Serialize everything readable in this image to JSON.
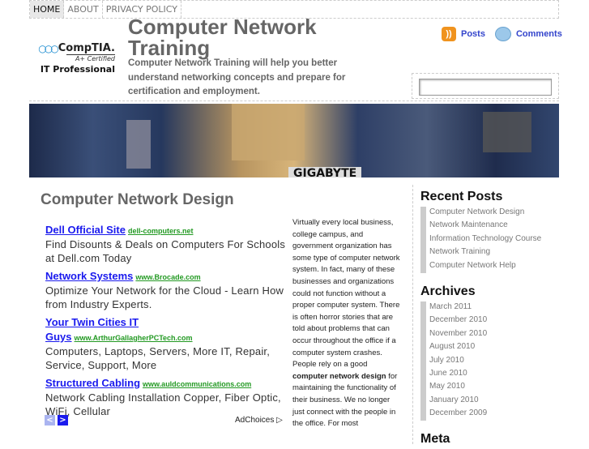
{
  "nav": {
    "items": [
      "HOME",
      "ABOUT",
      "PRIVACY POLICY"
    ]
  },
  "logo": {
    "brand": "CompTIA.",
    "cert": "A+ Certified",
    "role": "IT Professional"
  },
  "header": {
    "title": "Computer Network Training",
    "tagline": "Computer Network Training will help you better understand networking concepts and prepare for certification and employment.",
    "posts": "Posts",
    "comments": "Comments"
  },
  "banner": {
    "text": "GIGABYTE"
  },
  "post": {
    "title": "Computer Network Design",
    "body_before": "Virtually every local business, college campus, and government organization has some type of computer network system.  In fact, many of these businesses and organizations could not function without a proper computer system.   There is often horror stories that are told about problems that can occur throughout the office if a computer system crashes. People rely on a good ",
    "body_bold": "computer network design",
    "body_after": " for maintaining the functionality of their business.  We no longer just connect with the people in the office.  For most"
  },
  "ads": [
    {
      "title": "Dell Official Site",
      "url": "dell-computers.net",
      "desc": "Find Disounts & Deals on Computers For Schools at Dell.com Today"
    },
    {
      "title": "Network Systems",
      "url": "www.Brocade.com",
      "desc": "Optimize Your Network for the Cloud - Learn How from Industry Experts."
    },
    {
      "title": "Your Twin Cities IT Guys",
      "url": "www.ArthurGallagherPCTech.com",
      "desc": "Computers, Laptops, Servers, More IT, Repair, Service, Support, More"
    },
    {
      "title": "Structured Cabling",
      "url": "www.auldcommunications.com",
      "desc": "Network Cabling Installation Copper, Fiber Optic, WiFi, Cellular"
    }
  ],
  "adchoices": "AdChoices ▷",
  "sidebar": {
    "recent_title": "Recent Posts",
    "recent": [
      "Computer Network Design",
      "Network Maintenance",
      "Information Technology Course",
      "Network Training",
      "Computer Network Help"
    ],
    "archives_title": "Archives",
    "archives": [
      "March 2011",
      "December 2010",
      "November 2010",
      "August 2010",
      "July 2010",
      "June 2010",
      "May 2010",
      "January 2010",
      "December 2009"
    ],
    "meta_title": "Meta"
  }
}
